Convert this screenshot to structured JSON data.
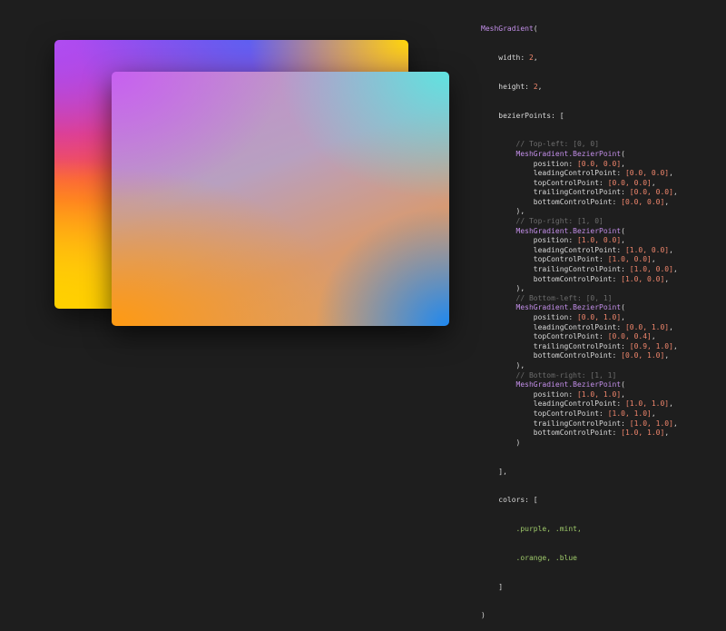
{
  "preview": {
    "back_card_colors": [
      "#a044f0",
      "#5f5ff0",
      "#ffd60a",
      "#f23a6a",
      "#ff6a2a",
      "#ffd000"
    ],
    "front_card_colors": [
      "#c760f0",
      "#5fe3e0",
      "#ff9a12",
      "#1e88f0"
    ]
  },
  "code": {
    "type_name": "MeshGradient",
    "width_label": "width",
    "width_value": "2",
    "height_label": "height",
    "height_value": "2",
    "bezier_label": "bezierPoints",
    "point_type": "MeshGradient.BezierPoint",
    "points": [
      {
        "comment": "// Top-left: [0, 0]",
        "position": "[0.0, 0.0]",
        "leading": "[0.0, 0.0]",
        "top": "[0.0, 0.0]",
        "trailing": "[0.0, 0.0]",
        "bottom": "[0.0, 0.0]"
      },
      {
        "comment": "// Top-right: [1, 0]",
        "position": "[1.0, 0.0]",
        "leading": "[1.0, 0.0]",
        "top": "[1.0, 0.0]",
        "trailing": "[1.0, 0.0]",
        "bottom": "[1.0, 0.0]"
      },
      {
        "comment": "// Bottom-left: [0, 1]",
        "position": "[0.0, 1.0]",
        "leading": "[0.0, 1.0]",
        "top": "[0.0, 0.4]",
        "trailing": "[0.9, 1.0]",
        "bottom": "[0.0, 1.0]"
      },
      {
        "comment": "// Bottom-right: [1, 1]",
        "position": "[1.0, 1.0]",
        "leading": "[1.0, 1.0]",
        "top": "[1.0, 1.0]",
        "trailing": "[1.0, 1.0]",
        "bottom": "[1.0, 1.0]"
      }
    ],
    "colors_label": "colors",
    "colors_line1": ".purple, .mint,",
    "colors_line2": ".orange, .blue"
  }
}
